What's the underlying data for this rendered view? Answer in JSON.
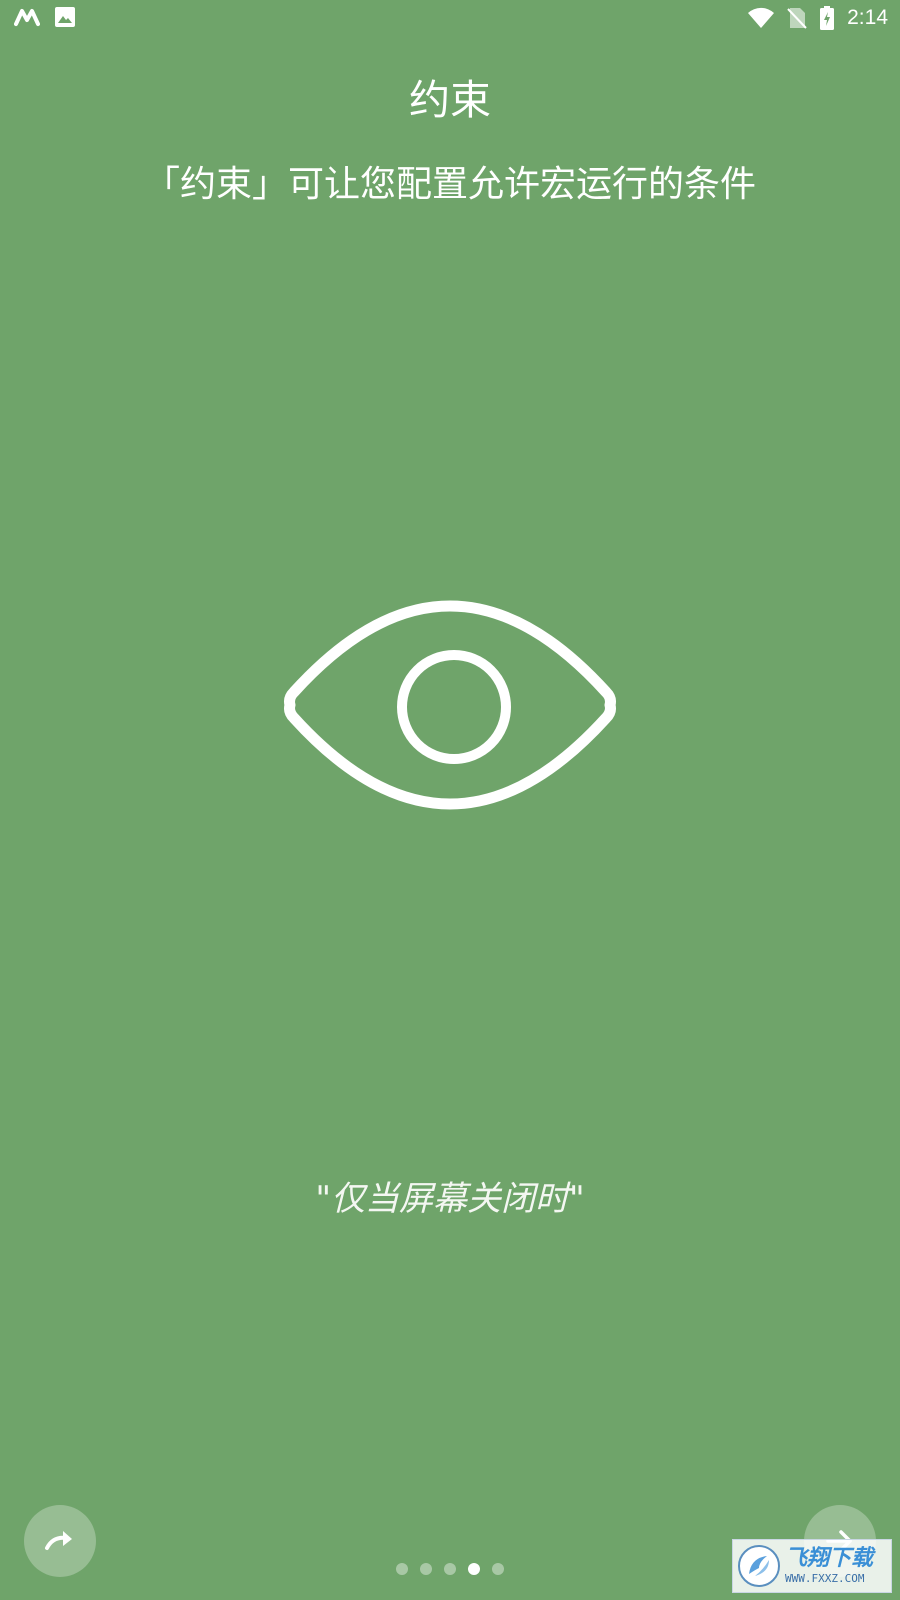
{
  "status_bar": {
    "time": "2:14",
    "icons": [
      "macrodroid-m-icon",
      "image-icon",
      "wifi-icon",
      "no-sim-icon",
      "battery-charging-icon"
    ]
  },
  "header": {
    "title": "约束",
    "subtitle": "「约束」可让您配置允许宏运行的条件"
  },
  "illustration": {
    "icon": "eye-icon"
  },
  "example": {
    "text": "\"仅当屏幕关闭时\""
  },
  "navigation": {
    "skip_icon": "skip-arrow-icon",
    "next_icon": "arrow-right-icon",
    "page_count": 5,
    "current_page": 4
  },
  "watermark": {
    "title": "飞翔下载",
    "url": "WWW.FXXZ.COM"
  },
  "colors": {
    "background": "#6fa46a",
    "foreground": "#ffffff"
  }
}
